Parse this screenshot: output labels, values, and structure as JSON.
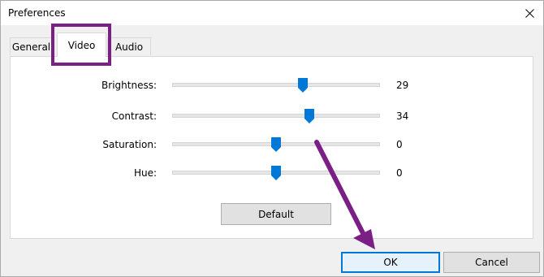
{
  "window": {
    "title": "Preferences"
  },
  "tabs": [
    {
      "label": "General"
    },
    {
      "label": "Video",
      "selected": true
    },
    {
      "label": "Audio"
    }
  ],
  "sliders": [
    {
      "label": "Brightness:",
      "value": "29",
      "level": 0.63
    },
    {
      "label": "Contrast:",
      "value": "34",
      "level": 0.66
    },
    {
      "label": "Saturation:",
      "value": "0",
      "level": 0.5
    },
    {
      "label": "Hue:",
      "value": "0",
      "level": 0.5
    }
  ],
  "buttons": {
    "default": "Default",
    "ok": "OK",
    "cancel": "Cancel"
  },
  "colors": {
    "accent": "#0078d7",
    "annotation": "#7b1f86"
  }
}
